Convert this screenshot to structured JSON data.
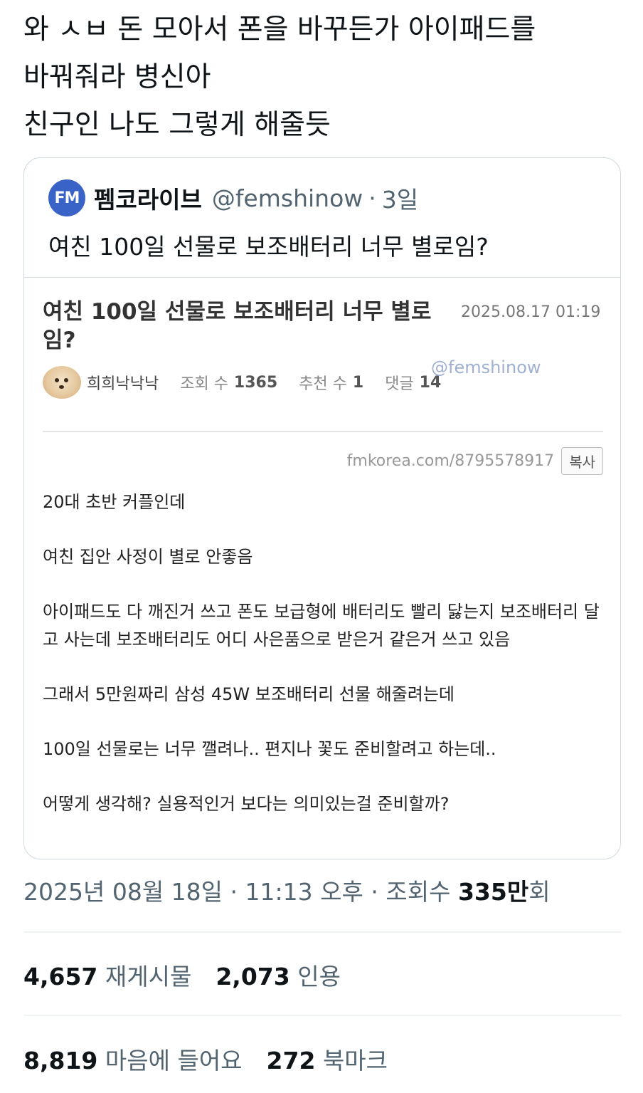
{
  "tweet": {
    "lines": [
      "와 ㅅㅂ 돈 모아서 폰을 바꾸든가 아이패드를",
      "바꿔줘라 병신아",
      "친구인 나도 그렇게 해줄듯"
    ]
  },
  "quote": {
    "avatar_text": "FM",
    "name": "펨코라이브",
    "handle": "@femshinow",
    "dot": "·",
    "time": "3일",
    "text": "여친 100일 선물로 보조배터리 너무 별로임?",
    "screenshot": {
      "title": "여친 100일 선물로 보조배터리 너무 별로임?",
      "date": "2025.08.17 01:19",
      "author": "희희낙낙낙",
      "views_label": "조회 수",
      "views": "1365",
      "recommend_label": "추천 수",
      "recommend": "1",
      "comments_label": "댓글",
      "comments": "14",
      "watermark": "@femshinow",
      "url": "fmkorea.com/8795578917",
      "copy_label": "복사",
      "body": [
        "20대 초반 커플인데",
        "여친 집안 사정이 별로 안좋음",
        "아이패드도 다 깨진거 쓰고 폰도 보급형에 배터리도 빨리 닳는지 보조배터리 달고 사는데 보조배터리도 어디 사은품으로 받은거 같은거 쓰고 있음",
        "그래서 5만원짜리 삼성 45W 보조배터리 선물 해줄려는데",
        "100일 선물로는 너무 깰려나.. 편지나 꽃도 준비할려고 하는데..",
        "어떻게 생각해? 실용적인거 보다는 의미있는걸 준비할까?"
      ]
    }
  },
  "meta": {
    "date": "2025년 08월 18일",
    "dot": "·",
    "time": "11:13 오후",
    "views_label": "조회수",
    "views_value": "335만",
    "views_suffix": "회"
  },
  "stats": {
    "retweets": "4,657",
    "retweets_label": "재게시물",
    "quotes": "2,073",
    "quotes_label": "인용",
    "likes": "8,819",
    "likes_label": "마음에 들어요",
    "bookmarks": "272",
    "bookmarks_label": "북마크"
  }
}
